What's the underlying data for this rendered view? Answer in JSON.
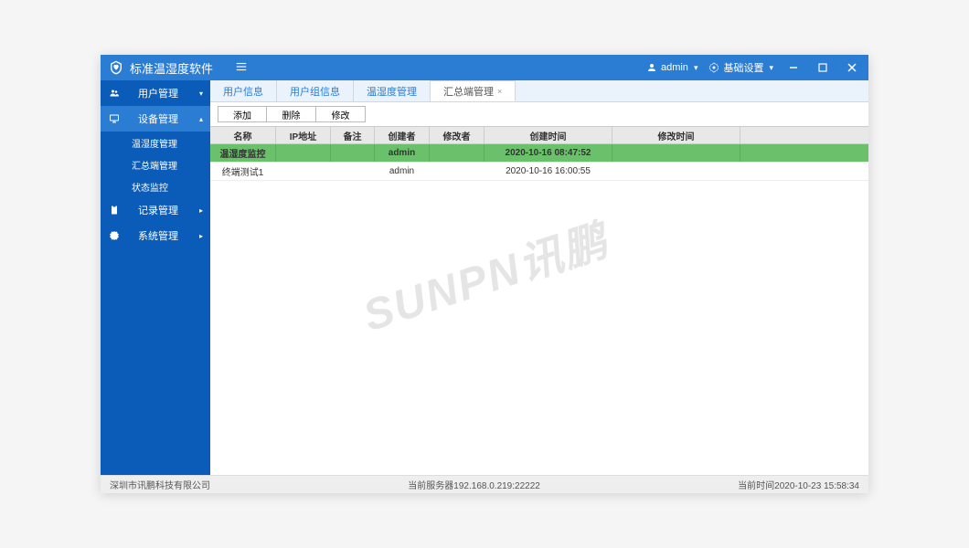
{
  "header": {
    "app_title": "标准温湿度软件",
    "user_label": "admin",
    "settings_label": "基础设置"
  },
  "sidebar": {
    "items": [
      {
        "label": "用户管理",
        "icon": "users"
      },
      {
        "label": "设备管理",
        "icon": "monitor",
        "expanded": true,
        "children": [
          {
            "label": "温湿度管理"
          },
          {
            "label": "汇总端管理"
          },
          {
            "label": "状态监控"
          }
        ]
      },
      {
        "label": "记录管理",
        "icon": "clipboard"
      },
      {
        "label": "系统管理",
        "icon": "gear"
      }
    ]
  },
  "tabs": [
    {
      "label": "用户信息"
    },
    {
      "label": "用户组信息"
    },
    {
      "label": "温湿度管理"
    },
    {
      "label": "汇总端管理",
      "active": true
    }
  ],
  "toolbar": {
    "add_label": "添加",
    "delete_label": "删除",
    "modify_label": "修改"
  },
  "table": {
    "columns": {
      "name": "名称",
      "ip": "IP地址",
      "remark": "备注",
      "creator": "创建者",
      "modifier": "修改者",
      "ctime": "创建时间",
      "mtime": "修改时间"
    },
    "rows": [
      {
        "name": "温湿度监控",
        "ip": "",
        "remark": "",
        "creator": "admin",
        "modifier": "",
        "ctime": "2020-10-16 08:47:52",
        "mtime": "",
        "selected": true
      },
      {
        "name": "终端测试1",
        "ip": "",
        "remark": "",
        "creator": "admin",
        "modifier": "",
        "ctime": "2020-10-16 16:00:55",
        "mtime": "",
        "selected": false
      }
    ]
  },
  "watermark": "SUNPN讯鹏",
  "footer": {
    "company": "深圳市讯鹏科技有限公司",
    "server_label": "当前服务器",
    "server_value": "192.168.0.219:22222",
    "time_label": "当前时间",
    "time_value": "2020-10-23 15:58:34"
  }
}
